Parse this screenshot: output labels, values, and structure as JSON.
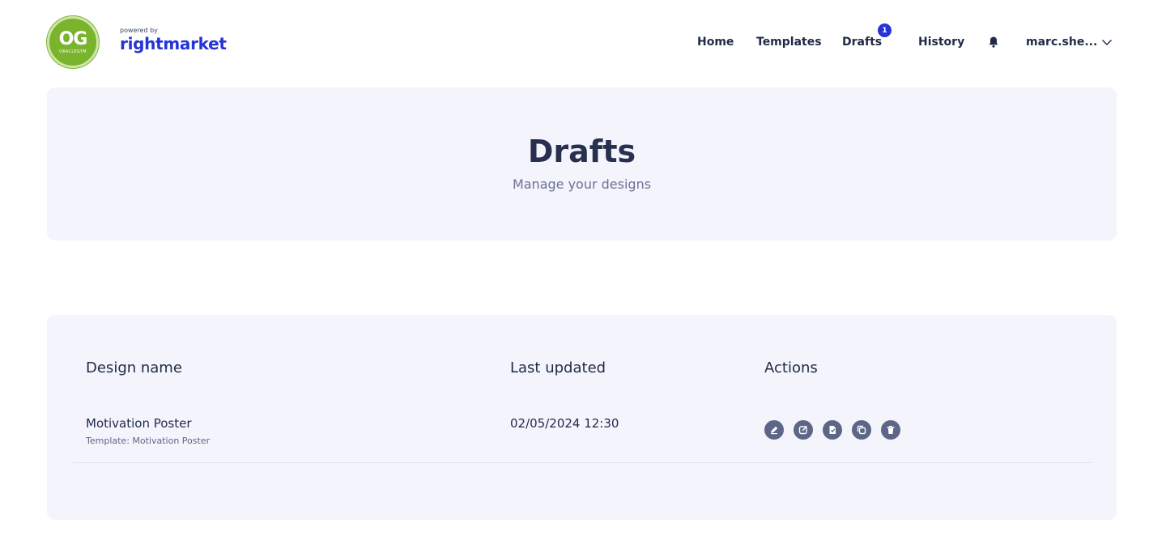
{
  "brand": {
    "logo_monogram": "OG",
    "logo_subtext": "ORACLEGYM",
    "powered_by": "powered by",
    "name": "rightmarket"
  },
  "nav": {
    "home": "Home",
    "templates": "Templates",
    "drafts": "Drafts",
    "drafts_badge": "1",
    "history": "History",
    "user": "marc.she..."
  },
  "hero": {
    "title": "Drafts",
    "subtitle": "Manage your designs"
  },
  "table": {
    "headers": {
      "name": "Design name",
      "updated": "Last updated",
      "actions": "Actions"
    },
    "rows": [
      {
        "name": "Motivation Poster",
        "template": "Template: Motivation Poster",
        "updated": "02/05/2024 12:30"
      }
    ],
    "action_icons": [
      "edit-icon",
      "open-editor-icon",
      "publish-icon",
      "duplicate-icon",
      "delete-icon"
    ]
  },
  "colors": {
    "accent": "#2434d6",
    "logo_green": "#7ab32e",
    "card_bg": "#f3f4fc",
    "icon_gray": "#5d6686"
  }
}
